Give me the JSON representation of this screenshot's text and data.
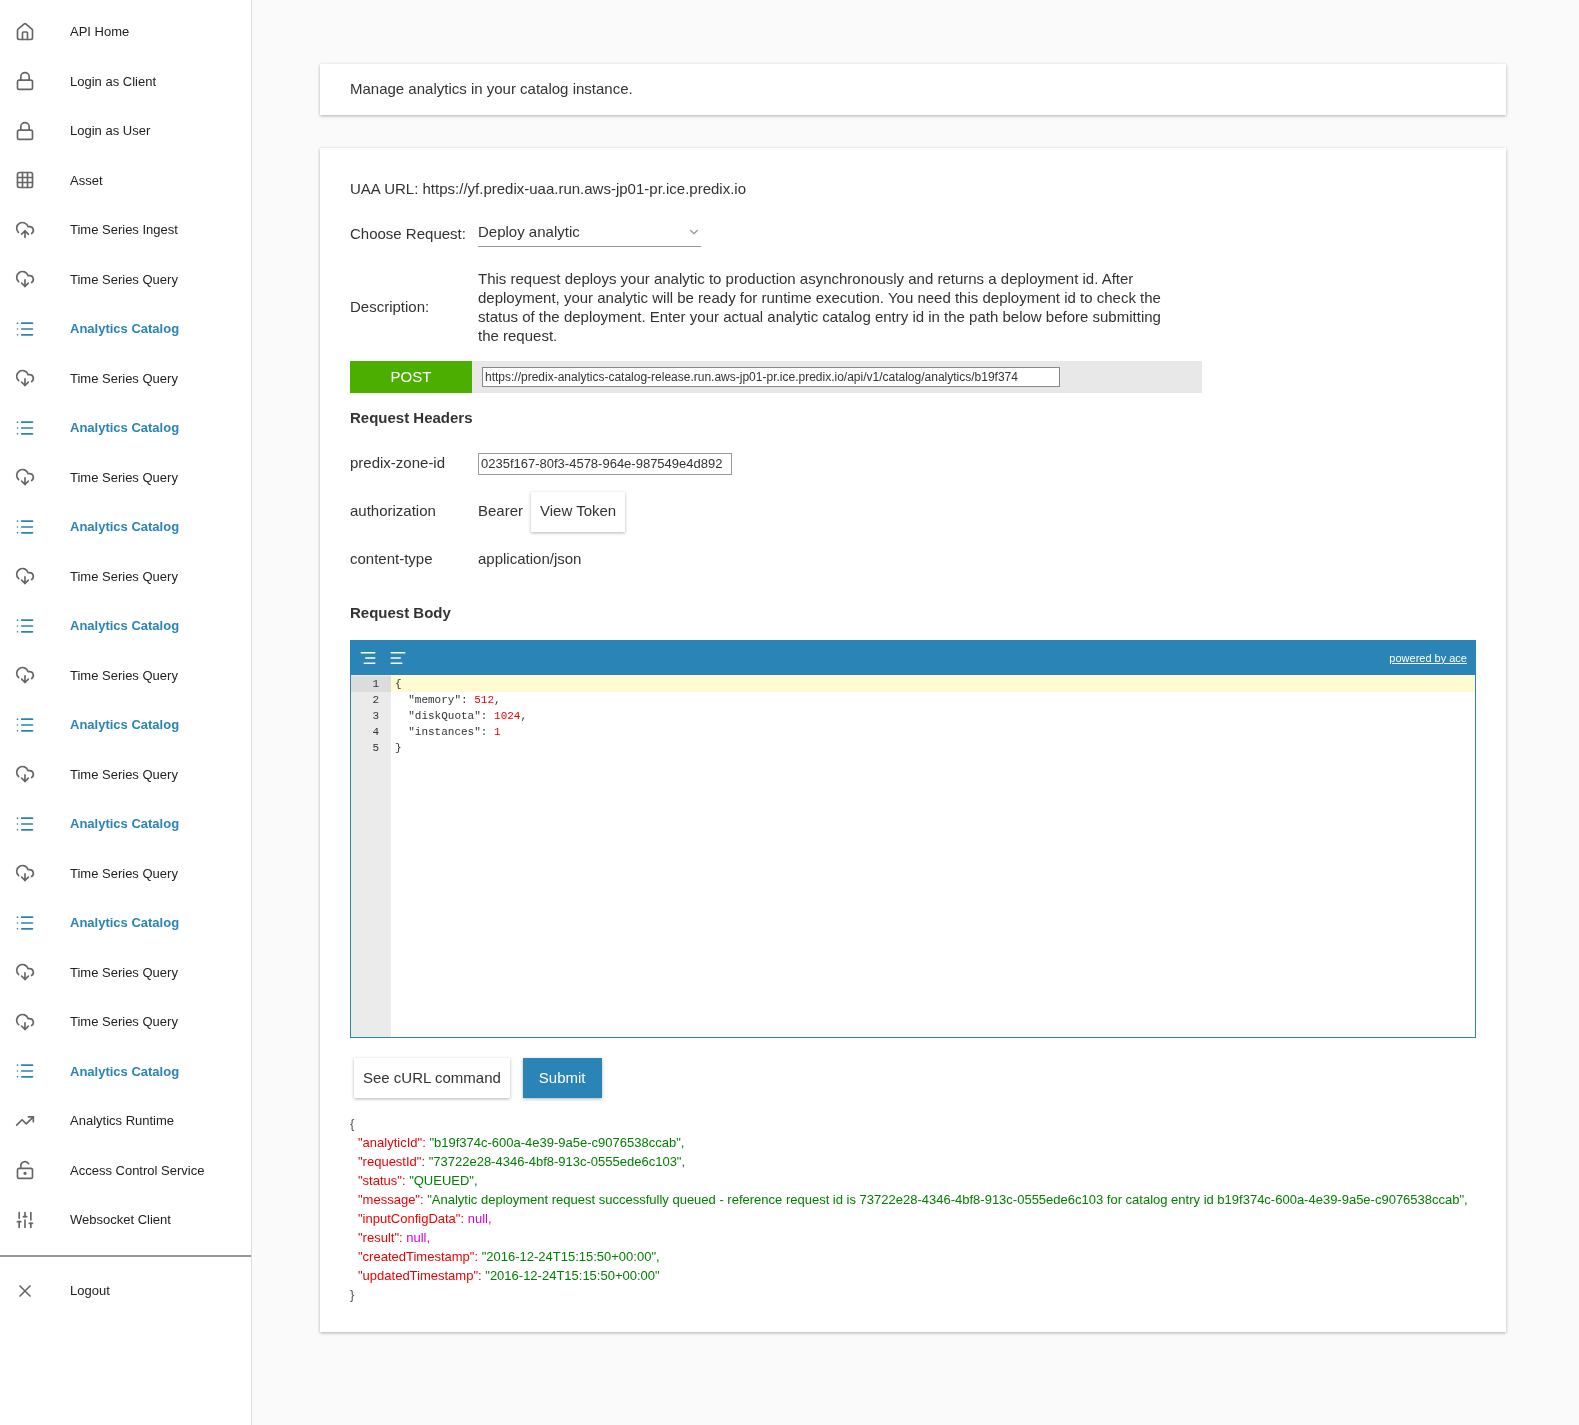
{
  "sidebar": {
    "items": [
      {
        "label": "API Home",
        "kind": "home",
        "highlighted": false
      },
      {
        "label": "Login as Client",
        "kind": "lock",
        "highlighted": false
      },
      {
        "label": "Login as User",
        "kind": "lock",
        "highlighted": false
      },
      {
        "label": "Asset",
        "kind": "grid",
        "highlighted": false
      },
      {
        "label": "Time Series Ingest",
        "kind": "upload",
        "highlighted": false
      },
      {
        "label": "Time Series Query",
        "kind": "download",
        "highlighted": false
      },
      {
        "label": "Analytics Catalog",
        "kind": "list",
        "highlighted": true
      },
      {
        "label": "Time Series Query",
        "kind": "download",
        "highlighted": false
      },
      {
        "label": "Analytics Catalog",
        "kind": "list",
        "highlighted": true
      },
      {
        "label": "Time Series Query",
        "kind": "download",
        "highlighted": false
      },
      {
        "label": "Analytics Catalog",
        "kind": "list",
        "highlighted": true
      },
      {
        "label": "Time Series Query",
        "kind": "download",
        "highlighted": false
      },
      {
        "label": "Analytics Catalog",
        "kind": "list",
        "highlighted": true
      },
      {
        "label": "Time Series Query",
        "kind": "download",
        "highlighted": false
      },
      {
        "label": "Analytics Catalog",
        "kind": "list",
        "highlighted": true
      },
      {
        "label": "Time Series Query",
        "kind": "download",
        "highlighted": false
      },
      {
        "label": "Analytics Catalog",
        "kind": "list",
        "highlighted": true
      },
      {
        "label": "Time Series Query",
        "kind": "download",
        "highlighted": false
      },
      {
        "label": "Analytics Catalog",
        "kind": "list",
        "highlighted": true
      },
      {
        "label": "Time Series Query",
        "kind": "download",
        "highlighted": false
      },
      {
        "label": "Time Series Query",
        "kind": "download",
        "highlighted": false
      },
      {
        "label": "Analytics Catalog",
        "kind": "list",
        "highlighted": true
      },
      {
        "label": "Analytics Runtime",
        "kind": "trend",
        "highlighted": false
      },
      {
        "label": "Access Control Service",
        "kind": "lock-open",
        "highlighted": false
      },
      {
        "label": "Websocket Client",
        "kind": "sliders",
        "highlighted": false
      }
    ],
    "footer": {
      "label": "Logout",
      "kind": "close"
    }
  },
  "intro": "Manage analytics in your catalog instance.",
  "request": {
    "uaa": "UAA URL: https://yf.predix-uaa.run.aws-jp01-pr.ice.predix.io",
    "choose_label": "Choose Request:",
    "choose_value": "Deploy analytic",
    "description_label": "Description:",
    "description": "This request deploys your analytic to production asynchronously and returns a deployment id. After deployment, your analytic will be ready for runtime execution. You need this deployment id to check the status of the deployment. Enter your actual analytic catalog entry id in the path below before submitting the request.",
    "method": "POST",
    "url": "https://predix-analytics-catalog-release.run.aws-jp01-pr.ice.predix.io/api/v1/catalog/analytics/b19f374",
    "headers_title": "Request Headers",
    "headers": [
      {
        "kind": "input",
        "name": "predix-zone-id",
        "value": "0235f167-80f3-4578-964e-987549e4d892"
      },
      {
        "kind": "token",
        "name": "authorization",
        "value": "Bearer",
        "button": "View Token"
      },
      {
        "kind": "text",
        "name": "content-type",
        "value": "application/json"
      }
    ],
    "body_title": "Request Body",
    "editor": {
      "powered": "powered by ace",
      "lines": [
        {
          "number": "1",
          "active": true,
          "tokens": [
            {
              "kind": "punct",
              "text": "{"
            }
          ]
        },
        {
          "number": "2",
          "active": false,
          "tokens": [
            {
              "kind": "punct",
              "text": "  \"memory\": "
            },
            {
              "kind": "number",
              "text": "512"
            },
            {
              "kind": "punct",
              "text": ","
            }
          ]
        },
        {
          "number": "3",
          "active": false,
          "tokens": [
            {
              "kind": "punct",
              "text": "  \"diskQuota\": "
            },
            {
              "kind": "number",
              "text": "1024"
            },
            {
              "kind": "punct",
              "text": ","
            }
          ]
        },
        {
          "number": "4",
          "active": false,
          "tokens": [
            {
              "kind": "punct",
              "text": "  \"instances\": "
            },
            {
              "kind": "number",
              "text": "1"
            }
          ]
        },
        {
          "number": "5",
          "active": false,
          "tokens": [
            {
              "kind": "punct",
              "text": "}"
            }
          ]
        }
      ]
    },
    "buttons": {
      "curl": "See cURL command",
      "submit": "Submit"
    },
    "response": [
      {
        "kind": "brace",
        "text": "{"
      },
      {
        "kind": "string",
        "key": "\"analyticId\": ",
        "value": "\"b19f374c-600a-4e39-9a5e-c9076538ccab\","
      },
      {
        "kind": "string",
        "key": "\"requestId\": ",
        "value": "\"73722e28-4346-4bf8-913c-0555ede6c103\","
      },
      {
        "kind": "string",
        "key": "\"status\": ",
        "value": "\"QUEUED\","
      },
      {
        "kind": "string",
        "key": "\"message\": ",
        "value": "\"Analytic deployment request successfully queued - reference request id is 73722e28-4346-4bf8-913c-0555ede6c103 for catalog entry id b19f374c-600a-4e39-9a5e-c9076538ccab\","
      },
      {
        "kind": "null",
        "key": "\"inputConfigData\": ",
        "value": "null,"
      },
      {
        "kind": "null",
        "key": "\"result\": ",
        "value": "null,"
      },
      {
        "kind": "string",
        "key": "\"createdTimestamp\": ",
        "value": "\"2016-12-24T15:15:50+00:00\","
      },
      {
        "kind": "string",
        "key": "\"updatedTimestamp\": ",
        "value": "\"2016-12-24T15:15:50+00:00\""
      },
      {
        "kind": "brace",
        "text": "}"
      }
    ]
  }
}
